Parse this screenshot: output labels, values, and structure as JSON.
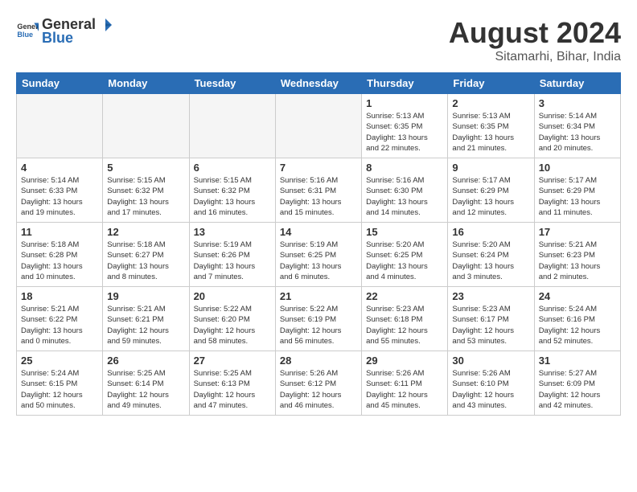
{
  "header": {
    "logo_general": "General",
    "logo_blue": "Blue",
    "title": "August 2024",
    "subtitle": "Sitamarhi, Bihar, India"
  },
  "days_of_week": [
    "Sunday",
    "Monday",
    "Tuesday",
    "Wednesday",
    "Thursday",
    "Friday",
    "Saturday"
  ],
  "weeks": [
    [
      {
        "day": "",
        "info": ""
      },
      {
        "day": "",
        "info": ""
      },
      {
        "day": "",
        "info": ""
      },
      {
        "day": "",
        "info": ""
      },
      {
        "day": "1",
        "info": "Sunrise: 5:13 AM\nSunset: 6:35 PM\nDaylight: 13 hours\nand 22 minutes."
      },
      {
        "day": "2",
        "info": "Sunrise: 5:13 AM\nSunset: 6:35 PM\nDaylight: 13 hours\nand 21 minutes."
      },
      {
        "day": "3",
        "info": "Sunrise: 5:14 AM\nSunset: 6:34 PM\nDaylight: 13 hours\nand 20 minutes."
      }
    ],
    [
      {
        "day": "4",
        "info": "Sunrise: 5:14 AM\nSunset: 6:33 PM\nDaylight: 13 hours\nand 19 minutes."
      },
      {
        "day": "5",
        "info": "Sunrise: 5:15 AM\nSunset: 6:32 PM\nDaylight: 13 hours\nand 17 minutes."
      },
      {
        "day": "6",
        "info": "Sunrise: 5:15 AM\nSunset: 6:32 PM\nDaylight: 13 hours\nand 16 minutes."
      },
      {
        "day": "7",
        "info": "Sunrise: 5:16 AM\nSunset: 6:31 PM\nDaylight: 13 hours\nand 15 minutes."
      },
      {
        "day": "8",
        "info": "Sunrise: 5:16 AM\nSunset: 6:30 PM\nDaylight: 13 hours\nand 14 minutes."
      },
      {
        "day": "9",
        "info": "Sunrise: 5:17 AM\nSunset: 6:29 PM\nDaylight: 13 hours\nand 12 minutes."
      },
      {
        "day": "10",
        "info": "Sunrise: 5:17 AM\nSunset: 6:29 PM\nDaylight: 13 hours\nand 11 minutes."
      }
    ],
    [
      {
        "day": "11",
        "info": "Sunrise: 5:18 AM\nSunset: 6:28 PM\nDaylight: 13 hours\nand 10 minutes."
      },
      {
        "day": "12",
        "info": "Sunrise: 5:18 AM\nSunset: 6:27 PM\nDaylight: 13 hours\nand 8 minutes."
      },
      {
        "day": "13",
        "info": "Sunrise: 5:19 AM\nSunset: 6:26 PM\nDaylight: 13 hours\nand 7 minutes."
      },
      {
        "day": "14",
        "info": "Sunrise: 5:19 AM\nSunset: 6:25 PM\nDaylight: 13 hours\nand 6 minutes."
      },
      {
        "day": "15",
        "info": "Sunrise: 5:20 AM\nSunset: 6:25 PM\nDaylight: 13 hours\nand 4 minutes."
      },
      {
        "day": "16",
        "info": "Sunrise: 5:20 AM\nSunset: 6:24 PM\nDaylight: 13 hours\nand 3 minutes."
      },
      {
        "day": "17",
        "info": "Sunrise: 5:21 AM\nSunset: 6:23 PM\nDaylight: 13 hours\nand 2 minutes."
      }
    ],
    [
      {
        "day": "18",
        "info": "Sunrise: 5:21 AM\nSunset: 6:22 PM\nDaylight: 13 hours\nand 0 minutes."
      },
      {
        "day": "19",
        "info": "Sunrise: 5:21 AM\nSunset: 6:21 PM\nDaylight: 12 hours\nand 59 minutes."
      },
      {
        "day": "20",
        "info": "Sunrise: 5:22 AM\nSunset: 6:20 PM\nDaylight: 12 hours\nand 58 minutes."
      },
      {
        "day": "21",
        "info": "Sunrise: 5:22 AM\nSunset: 6:19 PM\nDaylight: 12 hours\nand 56 minutes."
      },
      {
        "day": "22",
        "info": "Sunrise: 5:23 AM\nSunset: 6:18 PM\nDaylight: 12 hours\nand 55 minutes."
      },
      {
        "day": "23",
        "info": "Sunrise: 5:23 AM\nSunset: 6:17 PM\nDaylight: 12 hours\nand 53 minutes."
      },
      {
        "day": "24",
        "info": "Sunrise: 5:24 AM\nSunset: 6:16 PM\nDaylight: 12 hours\nand 52 minutes."
      }
    ],
    [
      {
        "day": "25",
        "info": "Sunrise: 5:24 AM\nSunset: 6:15 PM\nDaylight: 12 hours\nand 50 minutes."
      },
      {
        "day": "26",
        "info": "Sunrise: 5:25 AM\nSunset: 6:14 PM\nDaylight: 12 hours\nand 49 minutes."
      },
      {
        "day": "27",
        "info": "Sunrise: 5:25 AM\nSunset: 6:13 PM\nDaylight: 12 hours\nand 47 minutes."
      },
      {
        "day": "28",
        "info": "Sunrise: 5:26 AM\nSunset: 6:12 PM\nDaylight: 12 hours\nand 46 minutes."
      },
      {
        "day": "29",
        "info": "Sunrise: 5:26 AM\nSunset: 6:11 PM\nDaylight: 12 hours\nand 45 minutes."
      },
      {
        "day": "30",
        "info": "Sunrise: 5:26 AM\nSunset: 6:10 PM\nDaylight: 12 hours\nand 43 minutes."
      },
      {
        "day": "31",
        "info": "Sunrise: 5:27 AM\nSunset: 6:09 PM\nDaylight: 12 hours\nand 42 minutes."
      }
    ]
  ]
}
